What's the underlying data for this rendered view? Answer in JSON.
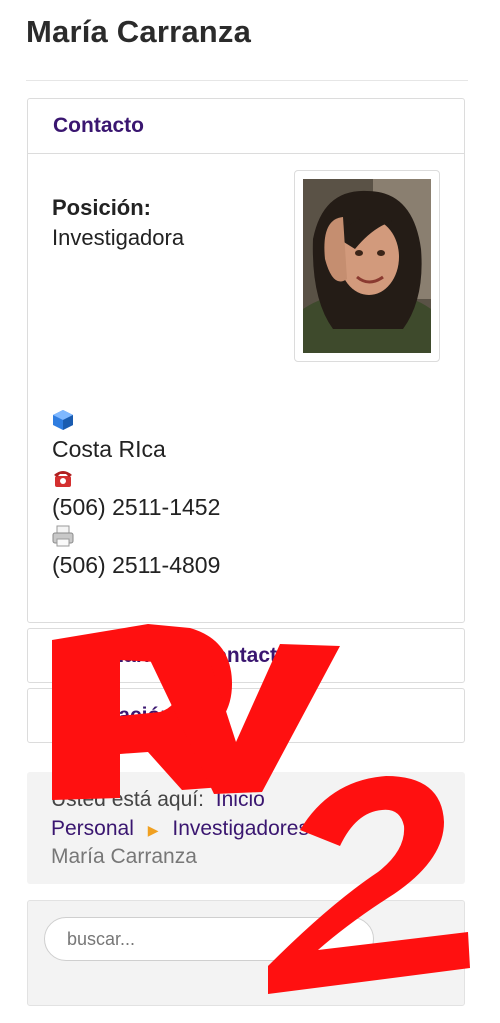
{
  "page": {
    "title": "María Carranza"
  },
  "contact_panel": {
    "heading": "Contacto",
    "position_label": "Posición:",
    "position_value": "Investigadora",
    "country": "Costa RIca",
    "phone": "(506) 2511-1452",
    "fax": "(506) 2511-4809",
    "icons": [
      "address-icon",
      "phone-icon",
      "fax-icon"
    ]
  },
  "form_panel": {
    "heading": "Formulario de Contacto"
  },
  "info_panel": {
    "heading": "Información"
  },
  "breadcrumb": {
    "prefix": "Usted está aquí:",
    "items": [
      "Inicio",
      "Personal",
      "Investigadores",
      "María Carranza"
    ]
  },
  "search": {
    "placeholder": "buscar..."
  },
  "watermark": {
    "text": "RV2",
    "color": "#ff1010"
  },
  "colors": {
    "accent": "#3a1670",
    "separator": "#f0a020"
  }
}
